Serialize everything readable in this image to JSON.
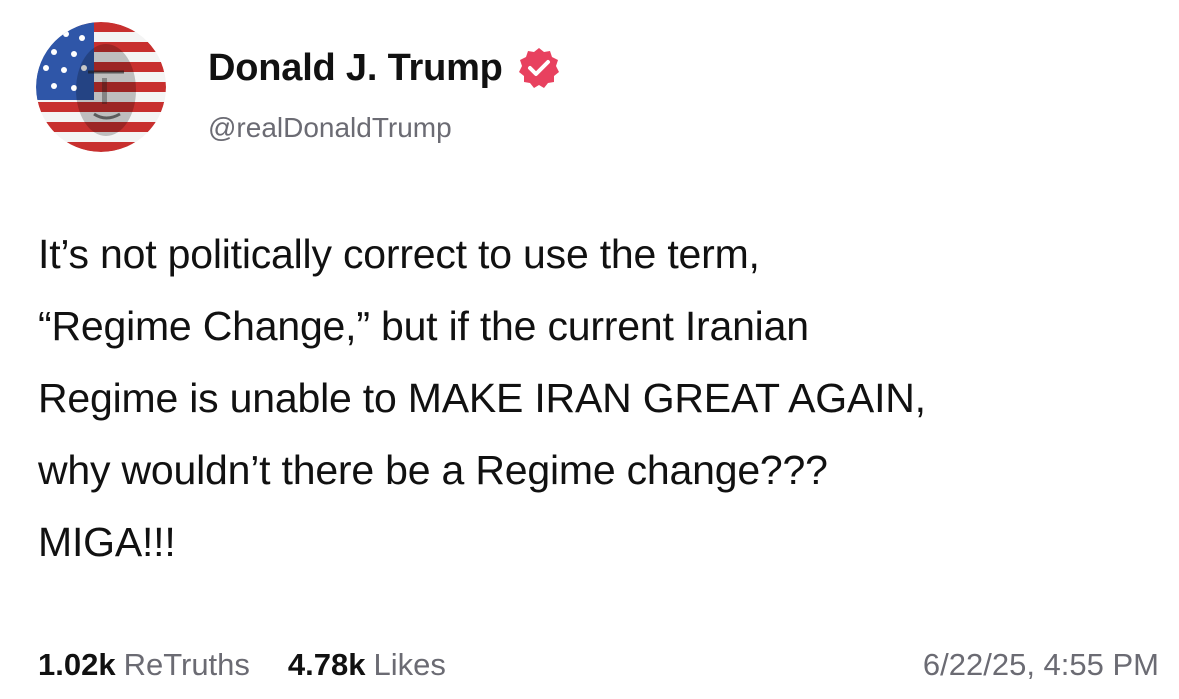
{
  "post": {
    "author": {
      "display_name": "Donald J. Trump",
      "handle": "@realDonaldTrump",
      "verified": true,
      "verified_badge_color": "#e8415f",
      "avatar_icon": "flag-face-avatar"
    },
    "content_lines": [
      "It’s not politically correct to use the term,",
      "“Regime Change,” but if the current Iranian",
      "Regime is unable to MAKE IRAN GREAT AGAIN,",
      "why wouldn’t there be a Regime change???",
      "MIGA!!!"
    ],
    "stats": {
      "retruths_count": "1.02k",
      "retruths_label": "ReTruths",
      "likes_count": "4.78k",
      "likes_label": "Likes"
    },
    "timestamp": "6/22/25, 4:55 PM"
  },
  "colors": {
    "text": "#111111",
    "muted": "#6b6b73",
    "background": "#ffffff"
  }
}
